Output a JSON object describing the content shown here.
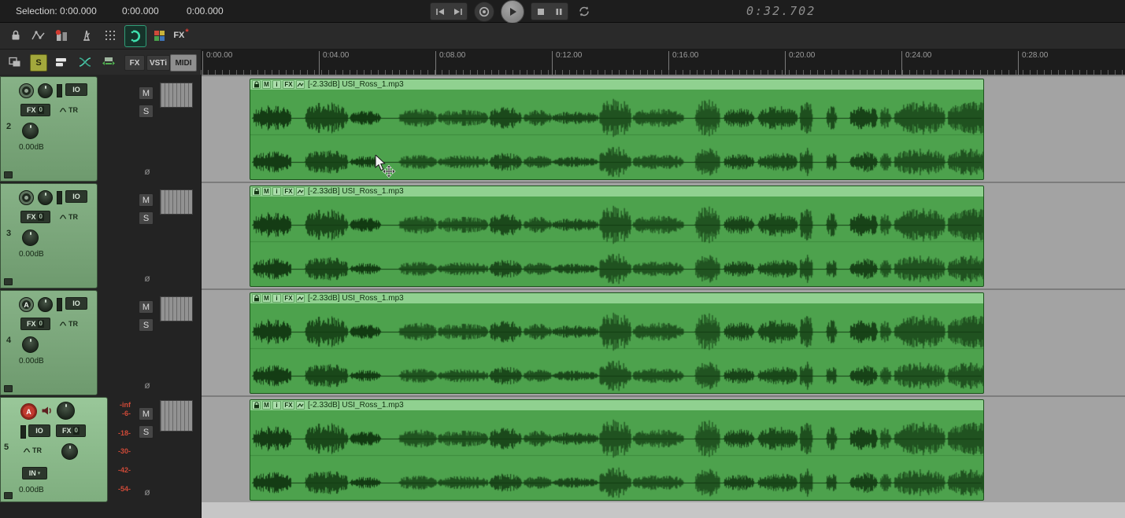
{
  "topbar": {
    "selection_label": "Selection: 0:00.000",
    "selection_start": "0:00.000",
    "selection_end": "0:00.000",
    "time_display": "0:32.702"
  },
  "toolbar1": {
    "fx_label": "FX",
    "fx_badge": "*"
  },
  "toolbar2": {
    "solo_label": "S",
    "fx_label": "FX",
    "vsti_label": "VSTi",
    "midi_label": "MIDI"
  },
  "ruler": {
    "ticks": [
      "0:00.00",
      "0:04.00",
      "0:08.00",
      "0:12.00",
      "0:16.00",
      "0:20.00",
      "0:24.00",
      "0:28.00"
    ]
  },
  "track_common": {
    "mute": "M",
    "solo": "S",
    "phase": "ø",
    "io": "IO",
    "fx": "FX",
    "fx_count": "0",
    "trim": "TR",
    "volume": "0.00dB",
    "input": "IN",
    "input_caret": "▾",
    "arm": "A"
  },
  "tracks": [
    {
      "number": "2"
    },
    {
      "number": "3"
    },
    {
      "number": "4"
    },
    {
      "number": "5"
    }
  ],
  "db_scale": [
    "-inf",
    "-6-",
    "-18-",
    "-30-",
    "-42-",
    "-54-"
  ],
  "item": {
    "mute": "M",
    "info": "i",
    "fx": "FX",
    "label": "[-2.33dB] USI_Ross_1.mp3"
  }
}
